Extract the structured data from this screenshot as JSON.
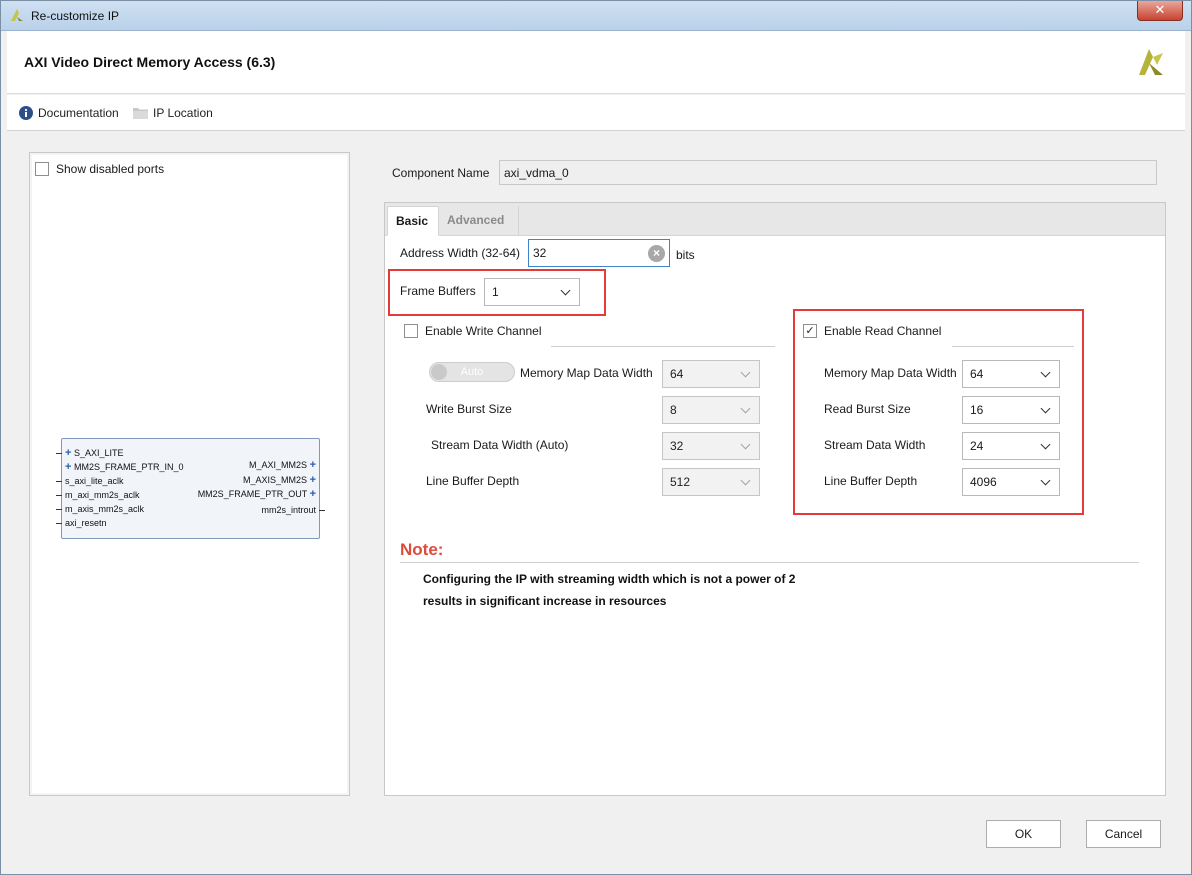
{
  "window": {
    "title": "Re-customize IP",
    "close_glyph": "✕"
  },
  "header": {
    "ip_title": "AXI Video Direct Memory Access (6.3)"
  },
  "toolbar": {
    "documentation": "Documentation",
    "ip_location": "IP Location"
  },
  "left_panel": {
    "show_disabled_ports": "Show disabled ports",
    "block": {
      "left_ports": [
        "S_AXI_LITE",
        "MM2S_FRAME_PTR_IN_0",
        "s_axi_lite_aclk",
        "m_axi_mm2s_aclk",
        "m_axis_mm2s_aclk",
        "axi_resetn"
      ],
      "right_ports": [
        "M_AXI_MM2S",
        "M_AXIS_MM2S",
        "MM2S_FRAME_PTR_OUT",
        "mm2s_introut"
      ]
    }
  },
  "component": {
    "label": "Component Name",
    "value": "axi_vdma_0"
  },
  "tabs": [
    {
      "label": "Basic"
    },
    {
      "label": "Advanced"
    }
  ],
  "basic": {
    "address_width_label": "Address Width (32-64)",
    "address_width_value": "32",
    "bits_label": "bits",
    "frame_buffers_label": "Frame Buffers",
    "frame_buffers_value": "1",
    "write_channel": {
      "enable_label": "Enable Write Channel",
      "checked": false,
      "auto_label": "Auto",
      "mm_data_width_label": "Memory Map Data Width",
      "mm_data_width_value": "64",
      "burst_size_label": "Write Burst Size",
      "burst_size_value": "8",
      "stream_width_label": "Stream Data Width (Auto)",
      "stream_width_value": "32",
      "line_buffer_label": "Line Buffer Depth",
      "line_buffer_value": "512"
    },
    "read_channel": {
      "enable_label": "Enable Read Channel",
      "checked": true,
      "check_glyph": "✓",
      "mm_data_width_label": "Memory Map Data Width",
      "mm_data_width_value": "64",
      "burst_size_label": "Read Burst Size",
      "burst_size_value": "16",
      "stream_width_label": "Stream Data Width",
      "stream_width_value": "24",
      "line_buffer_label": "Line Buffer Depth",
      "line_buffer_value": "4096"
    },
    "note": {
      "title": "Note:",
      "line1": "Configuring the IP with streaming width which is not a power of 2",
      "line2": "results in significant increase in resources"
    }
  },
  "buttons": {
    "ok": "OK",
    "cancel": "Cancel"
  },
  "colors": {
    "highlight": "#e33b3b",
    "note_title": "#e04a3a",
    "focus_border": "#3d84c8"
  },
  "icons": [
    "xilinx-logo-icon",
    "close-icon",
    "info-icon",
    "folder-icon",
    "clear-icon",
    "chevron-down-icon",
    "checkmark-icon"
  ]
}
